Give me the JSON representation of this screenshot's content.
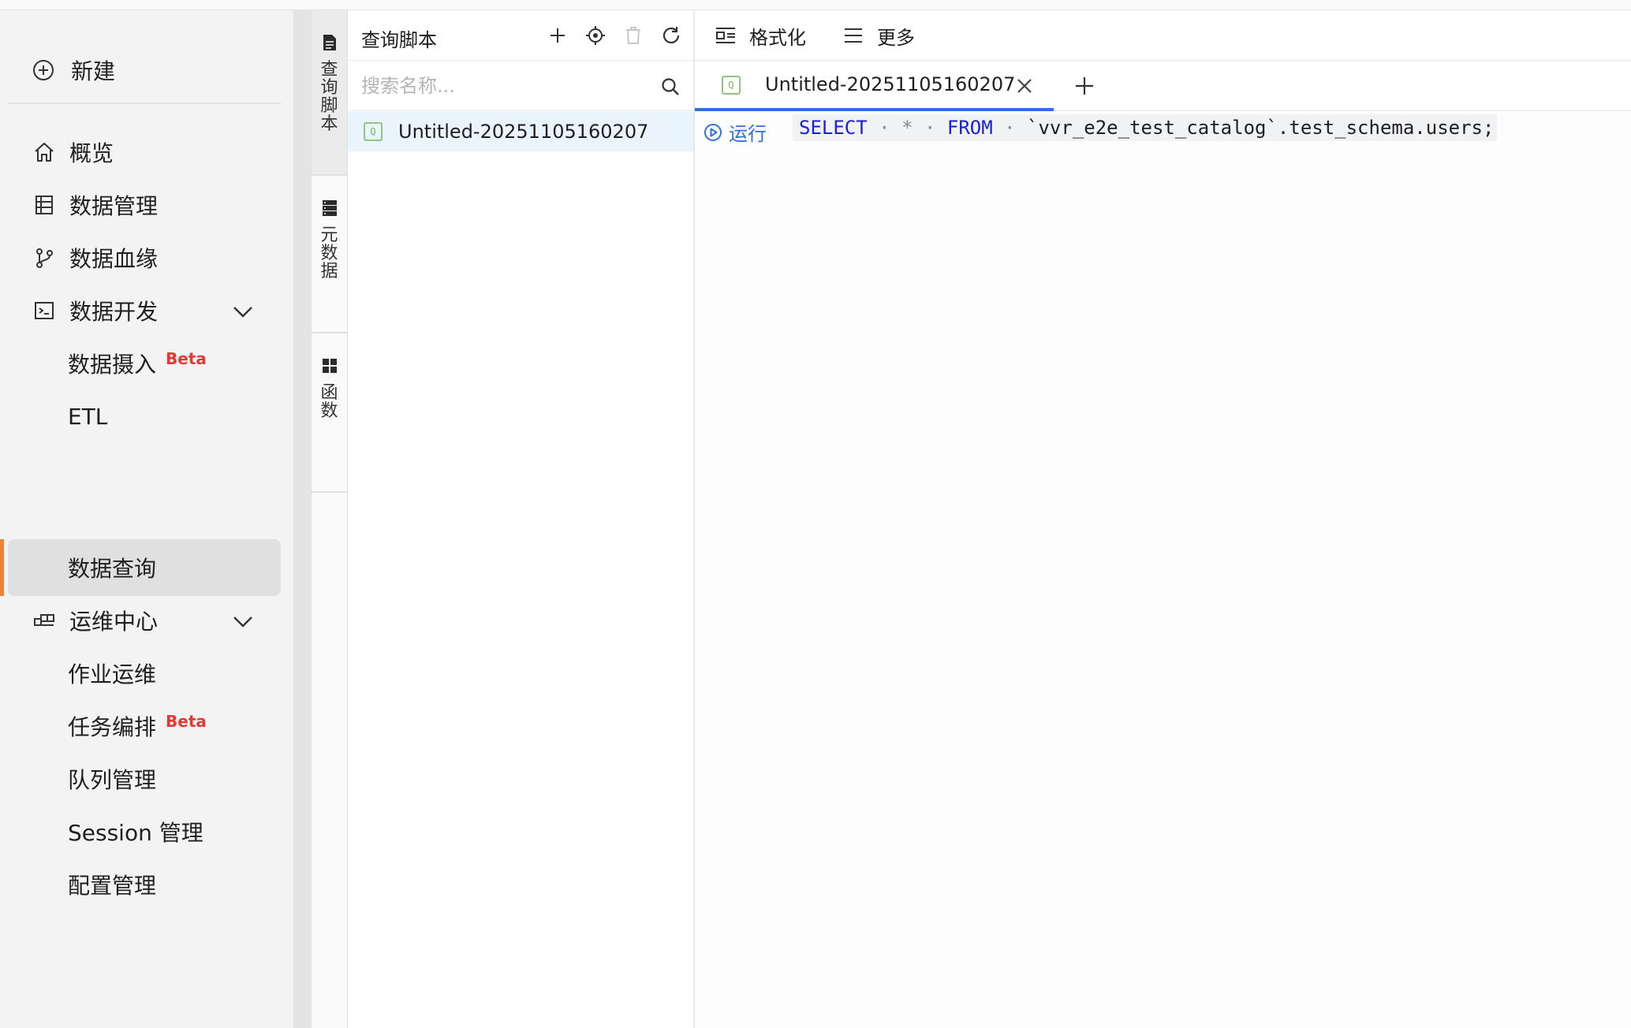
{
  "sidebar": {
    "new_label": "新建",
    "items": [
      {
        "label": "概览"
      },
      {
        "label": "数据管理"
      },
      {
        "label": "数据血缘"
      },
      {
        "label": "数据开发"
      },
      {
        "label": "数据摄入",
        "badge": "Beta"
      },
      {
        "label": "ETL"
      },
      {
        "label": "数据查询"
      },
      {
        "label": "运维中心"
      },
      {
        "label": "作业运维"
      },
      {
        "label": "任务编排",
        "badge": "Beta"
      },
      {
        "label": "队列管理"
      },
      {
        "label": "Session 管理"
      },
      {
        "label": "配置管理"
      }
    ],
    "active_item": "数据查询",
    "accent_color": "#f0803c"
  },
  "vertical_tabs": [
    {
      "label": "查询脚本",
      "icon": "document-icon"
    },
    {
      "label": "元数据",
      "icon": "database-icon"
    },
    {
      "label": "函数",
      "icon": "grid-icon"
    }
  ],
  "scripts_panel": {
    "title": "查询脚本",
    "search_placeholder": "搜索名称...",
    "scripts": [
      {
        "name": "Untitled-20251105160207",
        "badge": "Q"
      }
    ]
  },
  "editor": {
    "toolbar": {
      "format_label": "格式化",
      "more_label": "更多"
    },
    "tabs": [
      {
        "name": "Untitled-20251105160207",
        "badge": "Q"
      }
    ],
    "run_label": "运行",
    "code": {
      "kw_select": "SELECT",
      "star": "*",
      "kw_from": "FROM",
      "rest": "`vvr_e2e_test_catalog`.test_schema.users;"
    },
    "accent_color": "#2f6fde"
  }
}
